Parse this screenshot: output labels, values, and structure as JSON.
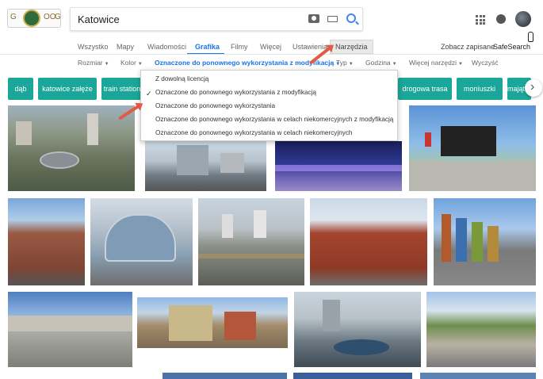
{
  "search": {
    "query": "Katowice"
  },
  "tabs": {
    "all": "Wszystko",
    "maps": "Mapy",
    "news": "Wiadomości",
    "images": "Grafika",
    "videos": "Filmy",
    "more": "Więcej",
    "settings": "Ustawienia",
    "tools": "Narzędzia",
    "saved": "Zobacz zapisane",
    "safesearch": "SafeSearch"
  },
  "filters": {
    "size": "Rozmiar",
    "color": "Kolor",
    "rights": "Oznaczone do ponownego wykorzystania z modyfikacją",
    "type": "Typ",
    "time": "Godzina",
    "more_tools": "Więcej narzędzi",
    "clear": "Wyczyść"
  },
  "dropdown": {
    "options": [
      "Z dowolną licencją",
      "Oznaczone do ponownego wykorzystania z modyfikacją",
      "Oznaczone do ponownego wykorzystania",
      "Oznaczone do ponownego wykorzystania w celach niekomercyjnych z modyfikacją",
      "Oznaczone do ponownego wykorzystania w celach niekomercyjnych"
    ],
    "selected_index": 1,
    "check_glyph": "✓"
  },
  "chips": [
    "dąb",
    "katowice załęże",
    "train station",
    "drogowa trasa",
    "moniuszki",
    "majątek"
  ],
  "colors": {
    "accent": "#1a73e8",
    "chip": "#1aa79a",
    "annotation_arrow": "#e05a45"
  },
  "icons": [
    "camera-icon",
    "keyboard-icon",
    "search-icon",
    "apps-grid-icon",
    "notifications-icon",
    "avatar",
    "chevron-right-icon",
    "hand-cursor-icon"
  ]
}
